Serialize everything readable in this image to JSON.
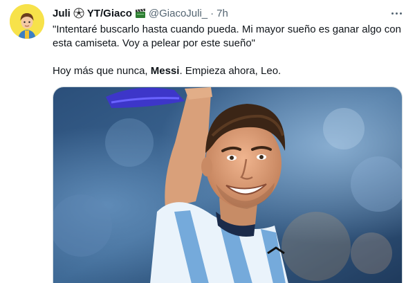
{
  "tweet": {
    "display_name": "Juli",
    "display_suffix": "YT/Giaco",
    "handle": "@GiacoJuli_",
    "separator": "·",
    "time": "7h",
    "text_line1": "\"Intentaré buscarlo hasta cuando pueda. Mi mayor sueño es ganar algo con esta camiseta. Voy a pelear por este sueño\"",
    "text_line2_before": "Hoy más que nunca, ",
    "text_line2_bold": "Messi",
    "text_line2_after": ". Empieza ahora, Leo."
  },
  "icons": {
    "more": "more-horizontal-icon",
    "ball": "soccer-ball-icon",
    "clapper": "clapperboard-icon",
    "avatar": "avatar-cartoon"
  },
  "colors": {
    "accent_text": "#0f1419",
    "muted": "#536471",
    "avatar_bg": "#f7e24a",
    "albiceleste": "#75aadb"
  }
}
